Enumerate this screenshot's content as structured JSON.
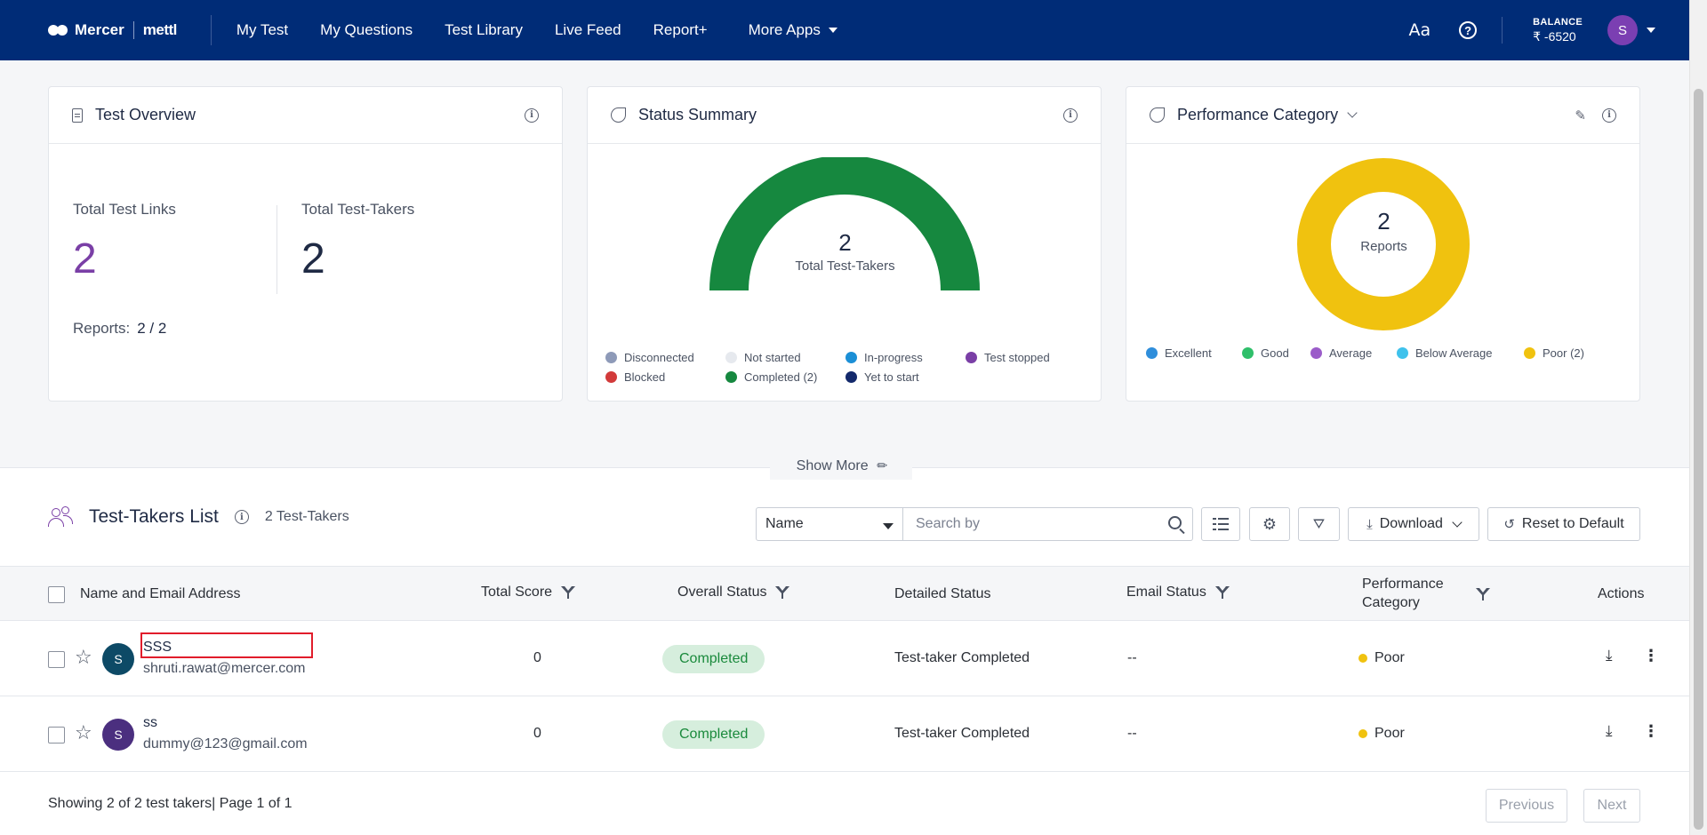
{
  "nav": {
    "brand": "Mercer",
    "brand_sub": "mettl",
    "links": [
      "My Test",
      "My Questions",
      "Test Library",
      "Live Feed",
      "Report+"
    ],
    "more_apps": "More Apps",
    "font_icon": "Aa",
    "balance_label": "BALANCE",
    "balance_value": "₹ -6520",
    "avatar_initial": "S"
  },
  "overview": {
    "title": "Test Overview",
    "links_label": "Total Test Links",
    "links_value": "2",
    "takers_label": "Total Test-Takers",
    "takers_value": "2",
    "reports_label": "Reports:",
    "reports_value": "2 / 2"
  },
  "status": {
    "title": "Status Summary",
    "center_value": "2",
    "center_label": "Total Test-Takers",
    "legend": [
      {
        "label": "Disconnected",
        "color": "#8e9ab8"
      },
      {
        "label": "Not started",
        "color": "#e6e9ee"
      },
      {
        "label": "In-progress",
        "color": "#1b8fd6"
      },
      {
        "label": "Test stopped",
        "color": "#7a3fa6"
      },
      {
        "label": "Blocked",
        "color": "#d23a3a"
      },
      {
        "label": "Completed (2)",
        "color": "#16883f"
      },
      {
        "label": "Yet to start",
        "color": "#13296b"
      }
    ],
    "completed_fraction": 1.0
  },
  "performance": {
    "title": "Performance Category",
    "center_value": "2",
    "center_label": "Reports",
    "legend": [
      {
        "label": "Excellent",
        "color": "#2f8edb"
      },
      {
        "label": "Good",
        "color": "#2fbf6a"
      },
      {
        "label": "Average",
        "color": "#9b5cc9"
      },
      {
        "label": "Below Average",
        "color": "#3fc2ec"
      },
      {
        "label": "Poor (2)",
        "color": "#f0c20f"
      }
    ],
    "poor_fraction": 1.0
  },
  "show_more": "Show More",
  "list": {
    "title": "Test-Takers List",
    "count": "2 Test-Takers",
    "select_value": "Name",
    "search_placeholder": "Search by",
    "download_label": "Download",
    "reset_label": "Reset to Default"
  },
  "table": {
    "headers": {
      "name": "Name and Email Address",
      "score": "Total Score",
      "overall": "Overall Status",
      "detailed": "Detailed Status",
      "email": "Email Status",
      "perf_line1": "Performance",
      "perf_line2": "Category",
      "actions": "Actions"
    },
    "rows": [
      {
        "initial": "S",
        "avatar_color": "#0d4a66",
        "name": "SSS",
        "email": "shruti.rawat@mercer.com",
        "score": "0",
        "overall": "Completed",
        "detailed": "Test-taker Completed",
        "email_status": "--",
        "performance": "Poor"
      },
      {
        "initial": "S",
        "avatar_color": "#4b2f7f",
        "name": "ss",
        "email": "dummy@123@gmail.com",
        "score": "0",
        "overall": "Completed",
        "detailed": "Test-taker Completed",
        "email_status": "--",
        "performance": "Poor"
      }
    ]
  },
  "footer": {
    "showing": "Showing 2 of 2 test takers| Page 1 of 1",
    "previous": "Previous",
    "next": "Next"
  }
}
